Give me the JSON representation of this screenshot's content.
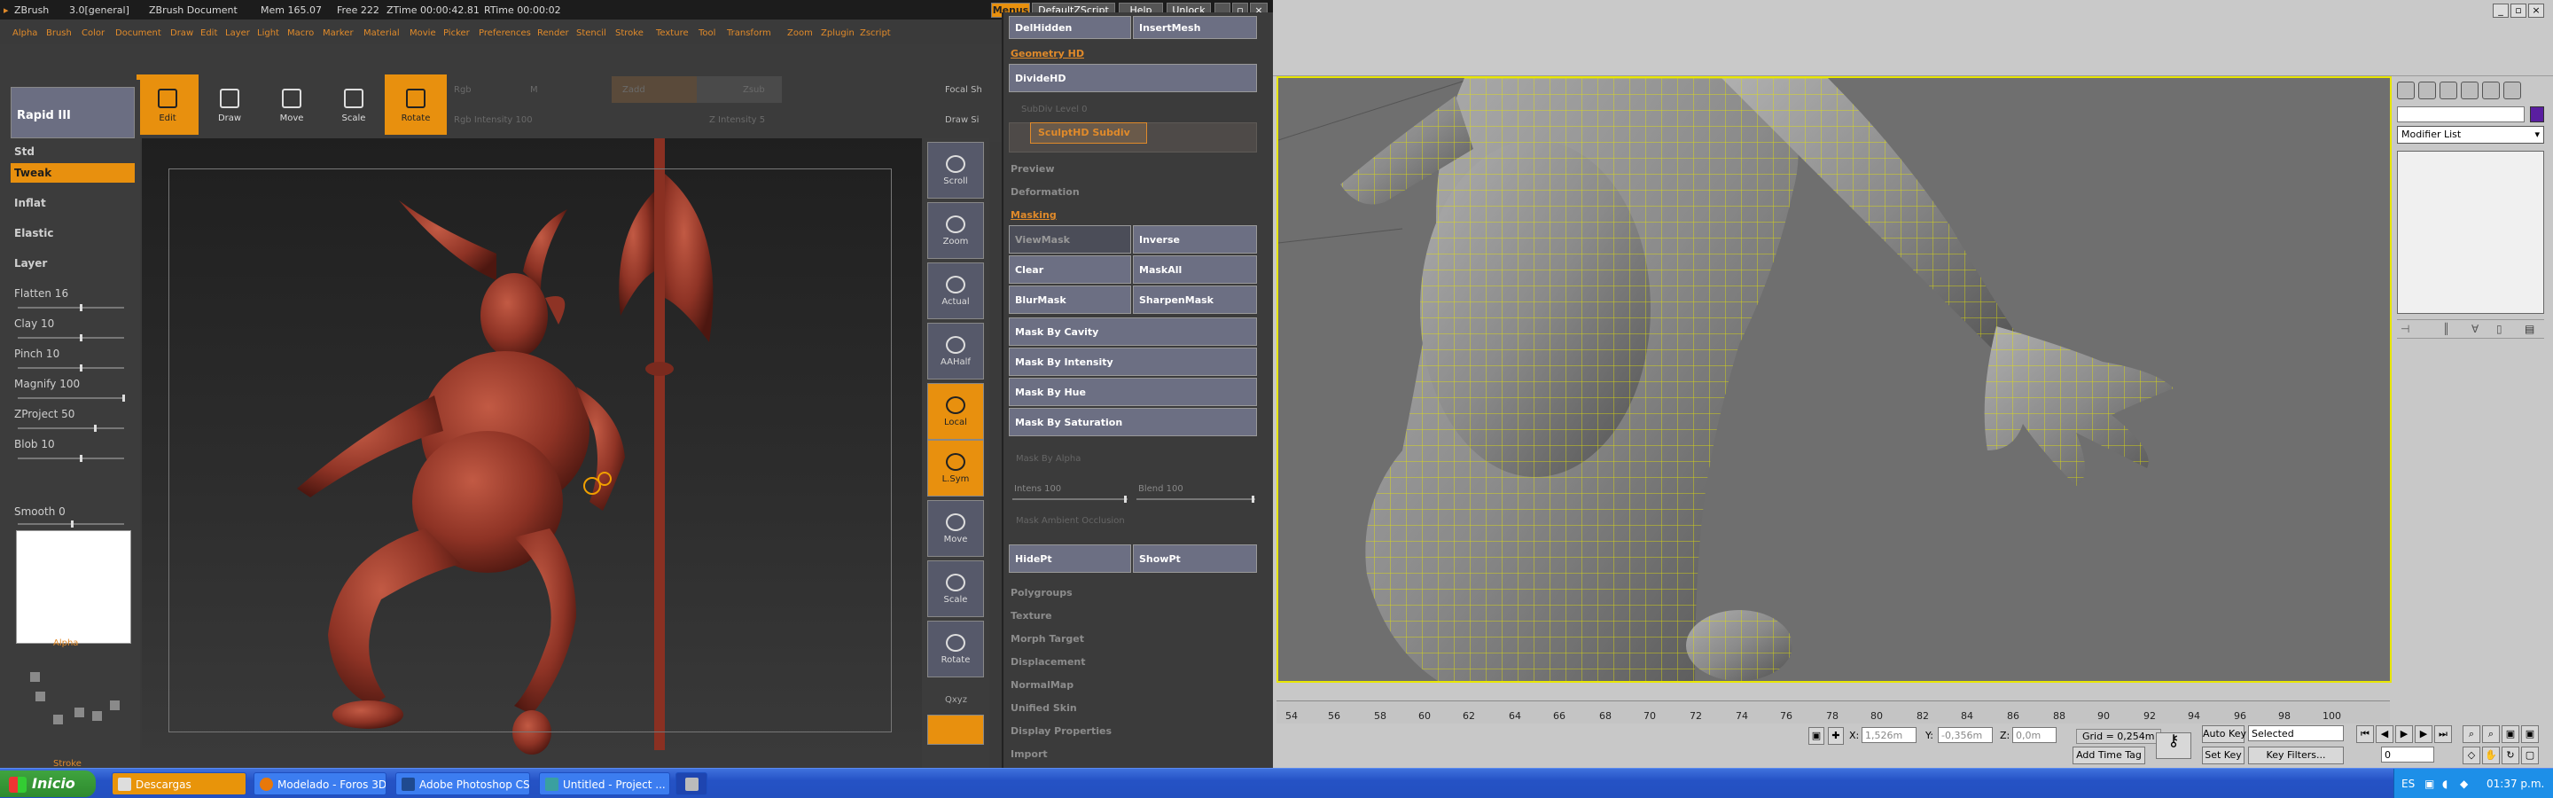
{
  "zbrush": {
    "title": {
      "app": "ZBrush",
      "version": "3.0[general]",
      "doc": "ZBrush Document",
      "mem": "Mem 165.07",
      "free": "Free 222",
      "ztime": "ZTime 00:00:42.81",
      "rtime": "RTime 00:00:02"
    },
    "topbuttons": [
      "Menus",
      "DefaultZScript",
      "Help",
      "Unlock"
    ],
    "menus": [
      "Alpha",
      "Brush",
      "Color",
      "Document",
      "Draw",
      "Edit",
      "Layer",
      "Light",
      "Macro",
      "Marker",
      "Material",
      "Movie",
      "Picker",
      "Preferences",
      "Render",
      "Stencil",
      "Stroke",
      "Texture",
      "Tool",
      "Transform",
      "Zoom",
      "Zplugin",
      "Zscript"
    ],
    "tools": [
      "Edit",
      "Draw",
      "Move",
      "Scale",
      "Rotate"
    ],
    "toolbar_dim": {
      "rgb": "Rgb",
      "m": "M",
      "zadd": "Zadd",
      "zsub": "Zsub",
      "focal_shift": "Focal Sh",
      "draw_size": "Draw Si",
      "rgb_intensity": "Rgb Intensity 100",
      "z_intensity": "Z Intensity 5"
    },
    "brush_title": "Rapid III",
    "brushes": [
      {
        "label": "Std"
      },
      {
        "label": "Tweak"
      },
      {
        "label": "Inflat"
      },
      {
        "label": "Elastic"
      },
      {
        "label": "Layer"
      },
      {
        "label": "Flatten 16"
      },
      {
        "label": "Clay 10"
      },
      {
        "label": "Pinch 10"
      },
      {
        "label": "Magnify 100"
      },
      {
        "label": "ZProject 50"
      },
      {
        "label": "Blob 10"
      },
      {
        "label": "Smooth 0"
      }
    ],
    "alpha_label": "Alpha",
    "stroke_label": "Stroke",
    "right_buttons": [
      "Scroll",
      "Zoom",
      "Actual",
      "AAHalf",
      "Local",
      "L.Sym",
      "Move",
      "Scale",
      "Rotate"
    ],
    "right_extra": "Qxyz",
    "panel": {
      "top_buttons": [
        "DelHidden",
        "InsertMesh"
      ],
      "geometry_hd": "Geometry HD",
      "dividehd": "DivideHD",
      "subdiv_dim": "SubDiv Level 0",
      "sculpthd": "SculptHD Subdiv",
      "links_top": [
        "Preview",
        "Deformation",
        "Masking"
      ],
      "viewmask": "ViewMask",
      "inverse": "Inverse",
      "clear": "Clear",
      "maskall": "MaskAll",
      "blurmask": "BlurMask",
      "sharpenmask": "SharpenMask",
      "mask_wide": [
        "Mask By Cavity",
        "Mask By Intensity",
        "Mask By Hue",
        "Mask By Saturation"
      ],
      "mask_alpha": "Mask By Alpha",
      "intens": "Intens 100",
      "blend": "Blend 100",
      "mask_ao": "Mask Ambient Occlusion",
      "hidept": "HidePt",
      "showpt": "ShowPt",
      "links_bottom": [
        "Polygroups",
        "Texture",
        "Morph Target",
        "Displacement",
        "NormalMap",
        "Unified Skin",
        "Display Properties",
        "Import"
      ]
    }
  },
  "max": {
    "modifier_list": "Modifier List",
    "timeline": [
      "54",
      "56",
      "58",
      "60",
      "62",
      "64",
      "66",
      "68",
      "70",
      "72",
      "74",
      "76",
      "78",
      "80",
      "82",
      "84",
      "86",
      "88",
      "90",
      "92",
      "94",
      "96",
      "98",
      "100"
    ],
    "x_label": "X:",
    "x_value": "1,526m",
    "y_label": "Y:",
    "y_value": "-0,356m",
    "z_label": "Z:",
    "z_value": "0,0m",
    "grid": "Grid = 0,254m",
    "add_time_tag": "Add Time Tag",
    "auto_key": "Auto Key",
    "selected": "Selected",
    "set_key": "Set Key",
    "key_filters": "Key Filters...",
    "frame": "0"
  },
  "taskbar": {
    "start": "Inicio",
    "tasks": [
      "Descargas",
      "Modelado - Foros 3D...",
      "Adobe Photoshop CS...",
      "Untitled - Project ...",
      ""
    ],
    "lang": "ES",
    "clock": "01:37 p.m."
  },
  "colors": {
    "zbrush_orange": "#e8900e",
    "wire_yellow": "#e8e600",
    "model_red": "#9b3a2a"
  }
}
